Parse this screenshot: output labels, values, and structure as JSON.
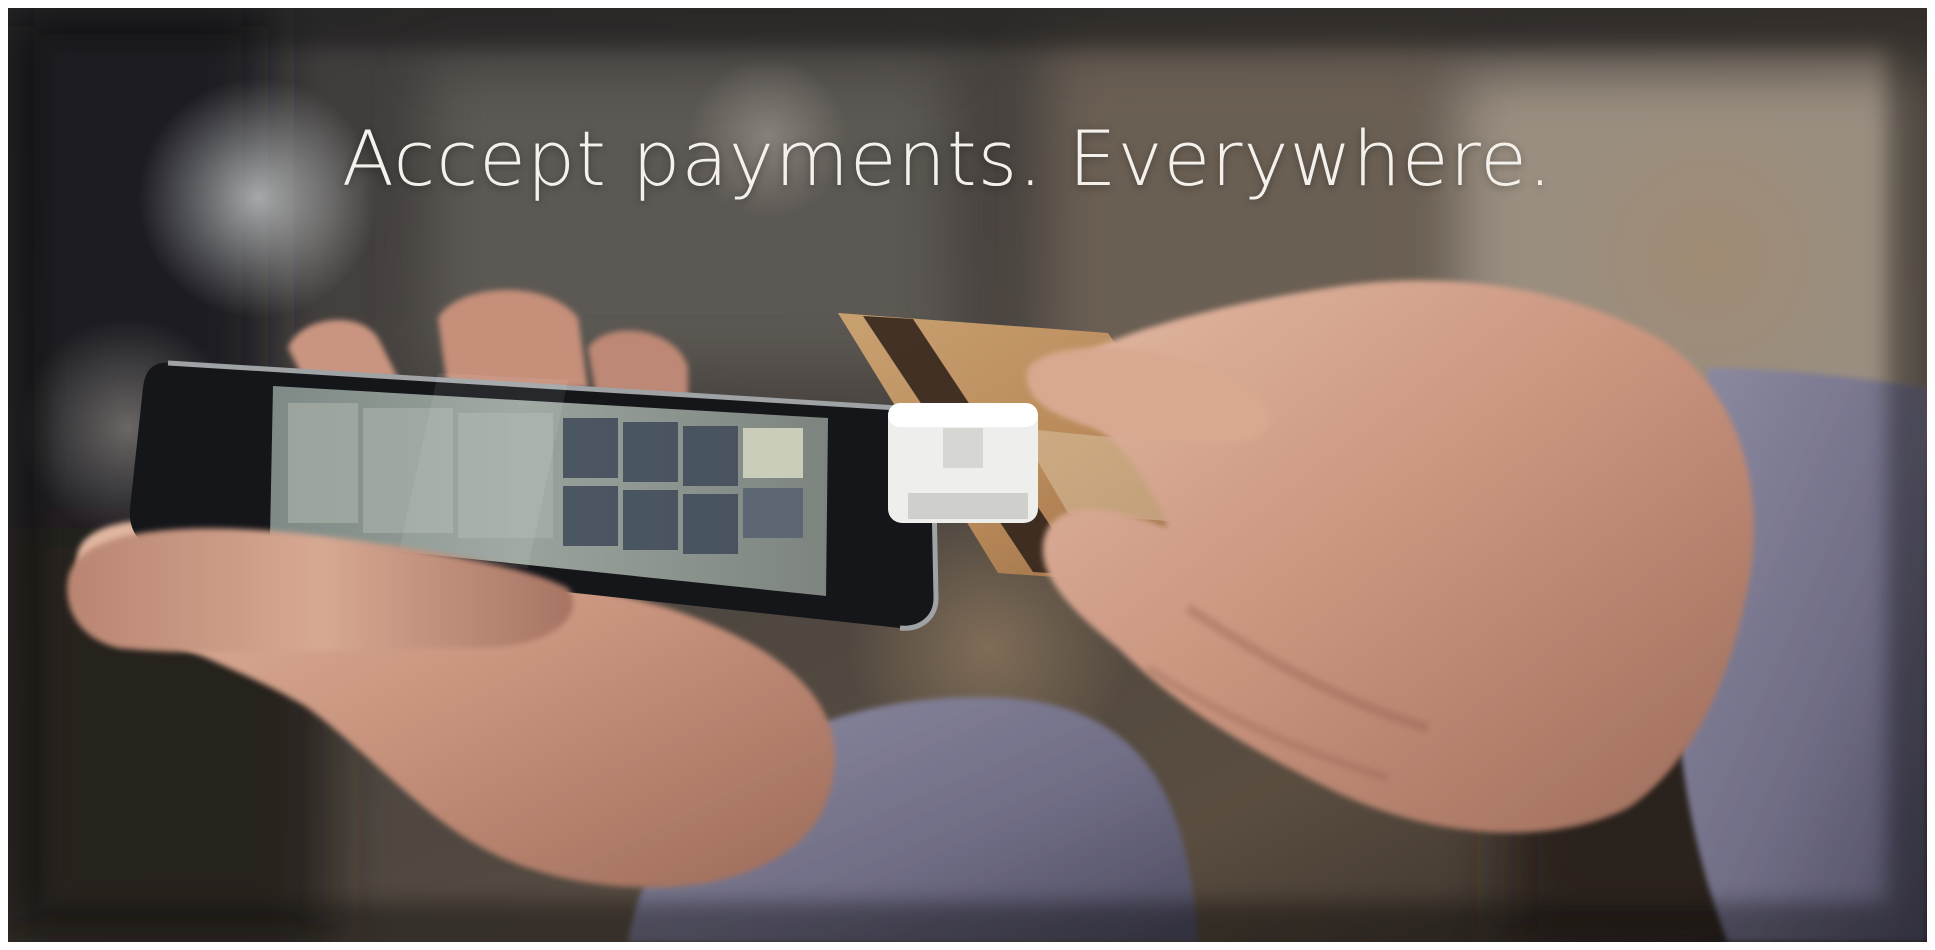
{
  "banner": {
    "headline": "Accept payments. Everywhere."
  },
  "colors": {
    "background": "#2b2724",
    "headline_text": "#f4f1ec",
    "sleeve": "#6e6c84",
    "skin": "#c99580",
    "card": "#b98a5a",
    "reader": "#eeeeec",
    "phone_body": "#15161a"
  }
}
